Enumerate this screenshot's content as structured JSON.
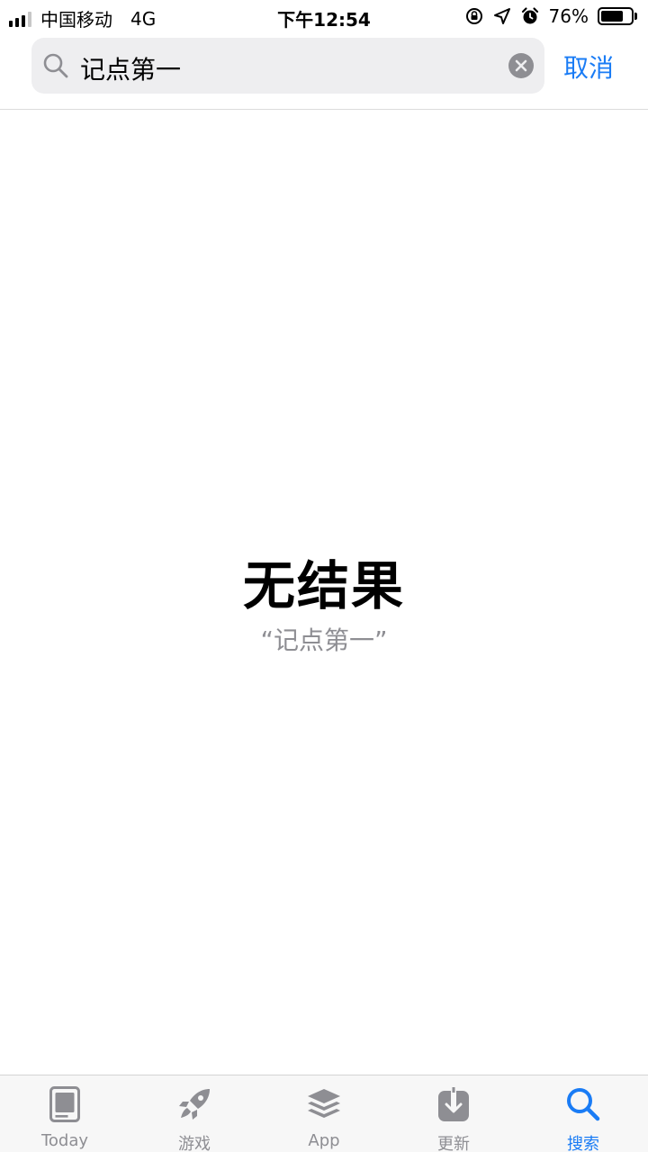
{
  "status_bar": {
    "carrier": "中国移动",
    "network": "4G",
    "time": "下午12:54",
    "battery_percent": "76%",
    "battery_level": 0.76
  },
  "search": {
    "query": "记点第一",
    "cancel_label": "取消"
  },
  "empty_state": {
    "title": "无结果",
    "query_quoted": "“记点第一”"
  },
  "tab_bar": {
    "tabs": [
      {
        "label": "Today",
        "icon": "today-icon"
      },
      {
        "label": "游戏",
        "icon": "rocket-icon"
      },
      {
        "label": "App",
        "icon": "layers-icon"
      },
      {
        "label": "更新",
        "icon": "download-icon"
      },
      {
        "label": "搜索",
        "icon": "search-icon"
      }
    ],
    "active_index": 4
  },
  "colors": {
    "accent": "#1a7cf5",
    "inactive": "#8e8e93",
    "field_bg": "#eeeef0"
  }
}
